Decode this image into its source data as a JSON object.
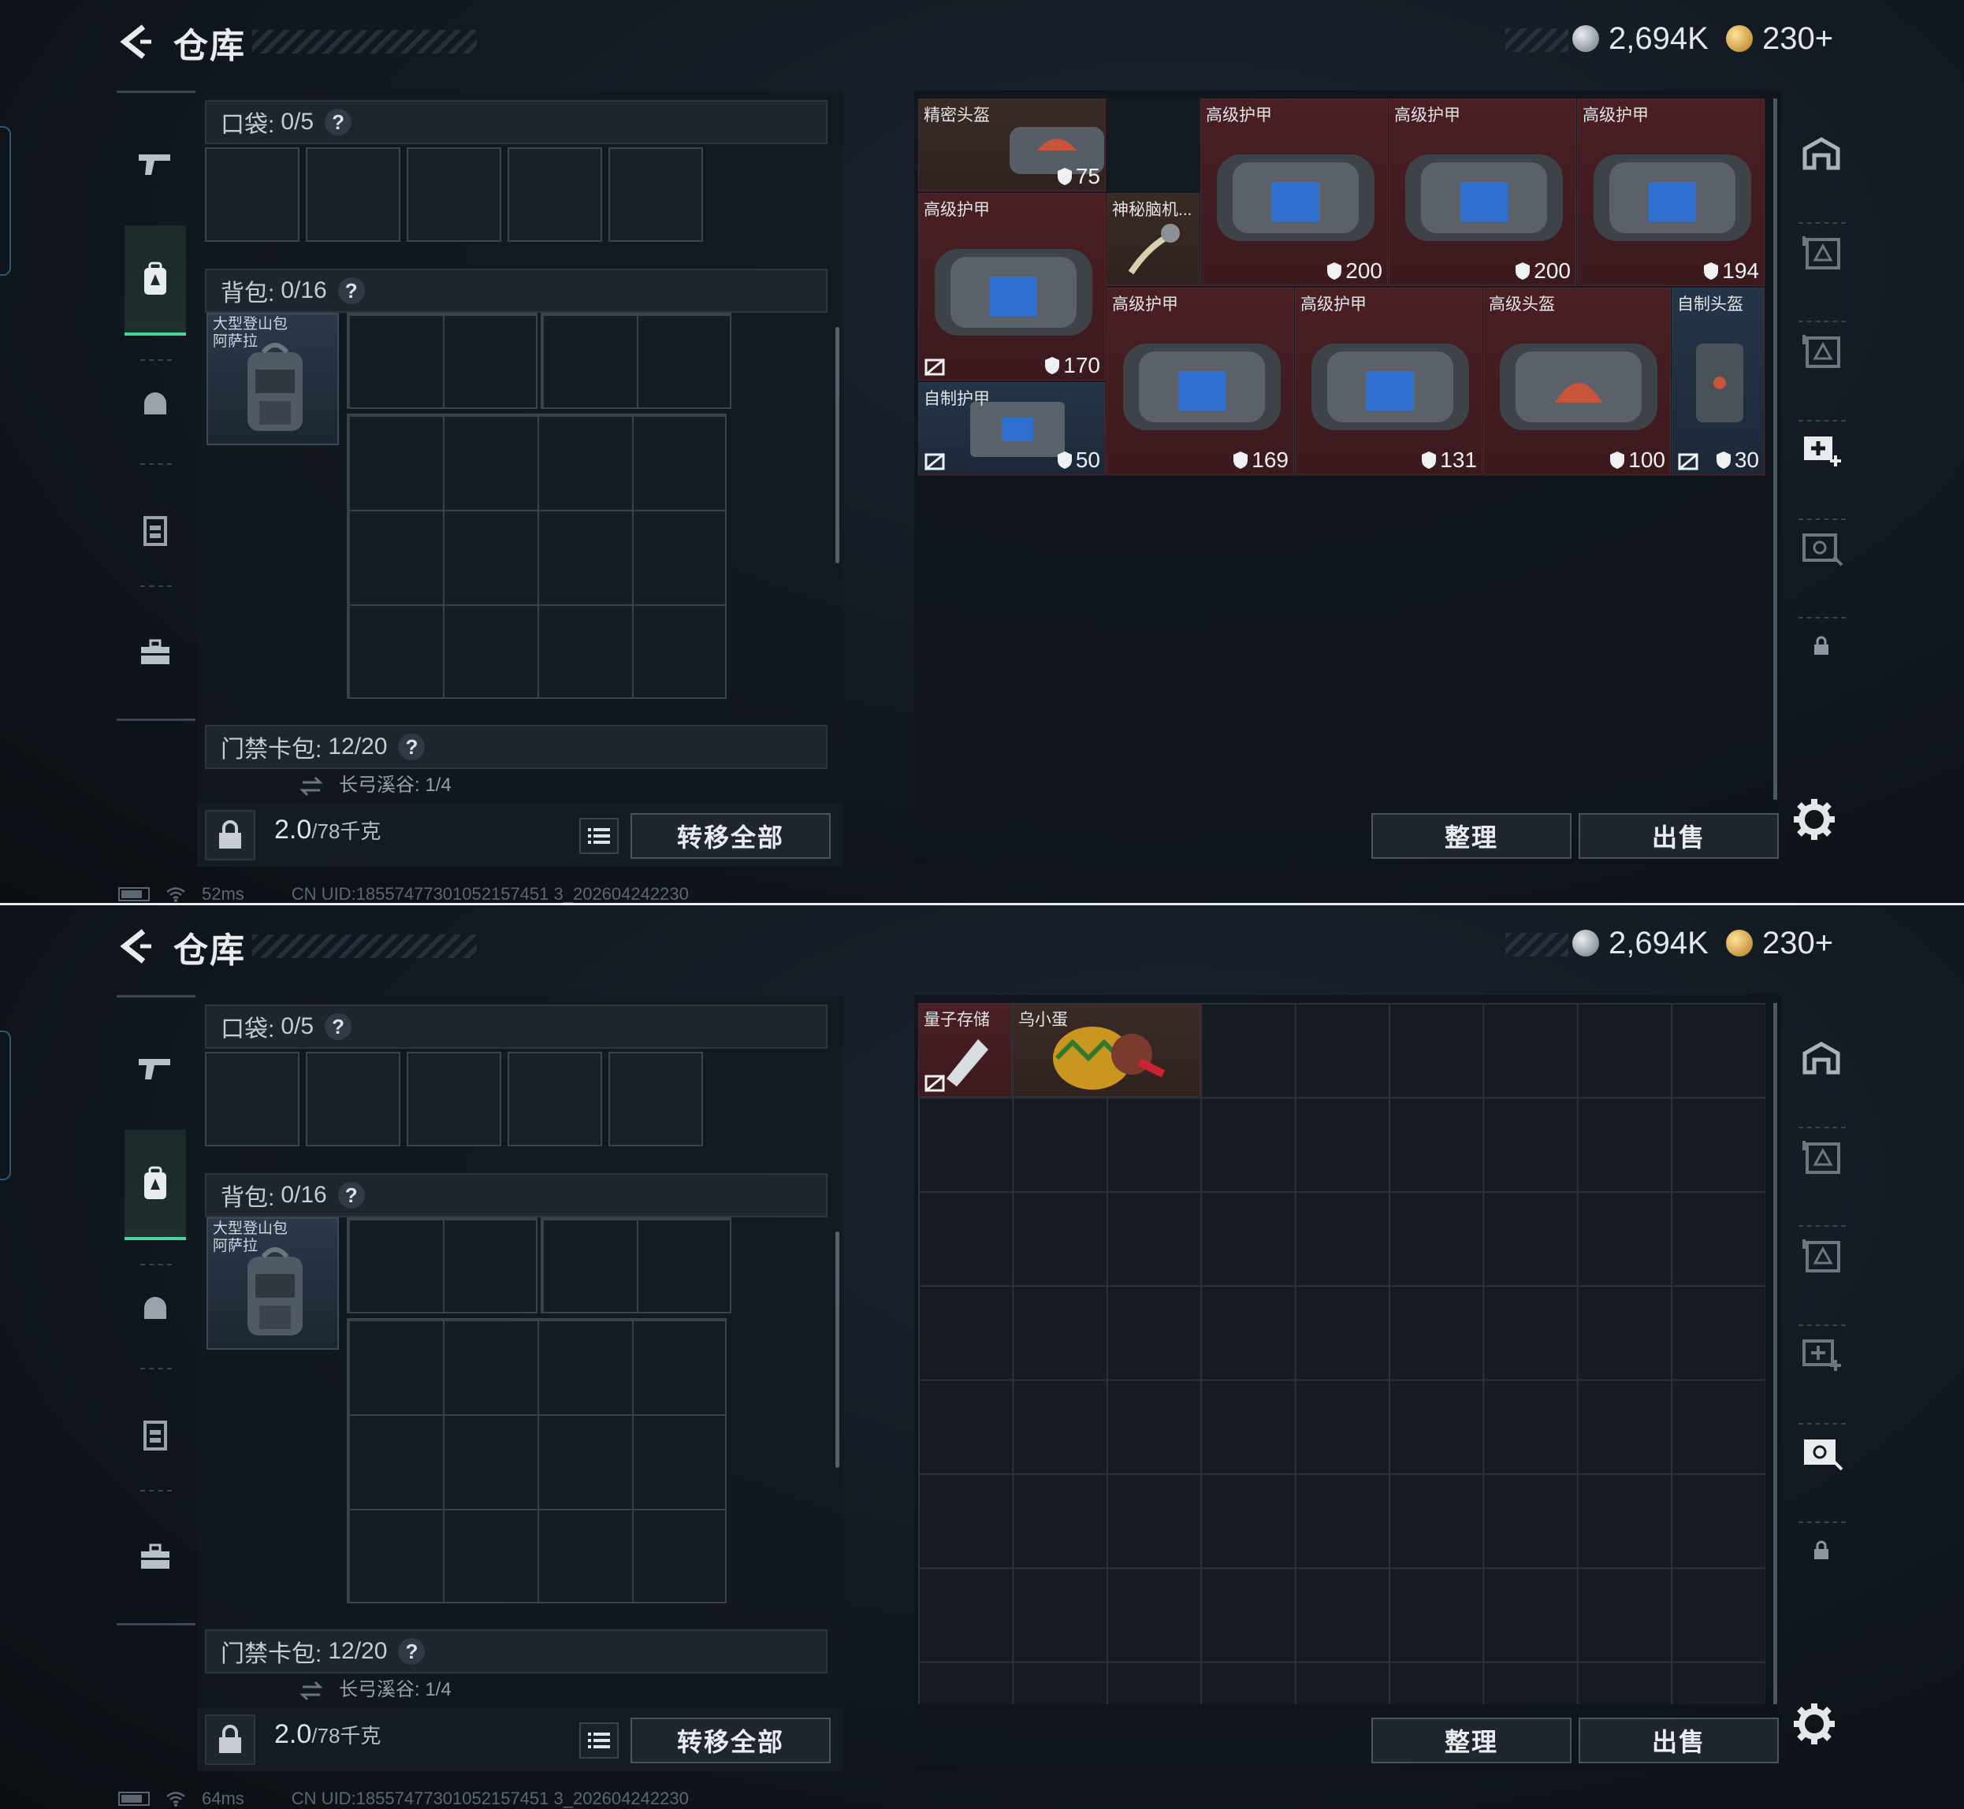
{
  "screens": [
    {
      "title": "仓库",
      "currency": {
        "silver": "2,694K",
        "gold": "230+"
      },
      "pocket": {
        "label": "口袋:",
        "value": "0/5"
      },
      "backpack": {
        "label": "背包:",
        "value": "0/16",
        "item_name": "大型登山包\n阿萨拉"
      },
      "card_pack": {
        "label": "门禁卡包:",
        "value": "12/20",
        "sub": "长弓溪谷: 1/4"
      },
      "weight": {
        "current": "2.0",
        "max": "/78千克"
      },
      "transfer_label": "转移全部",
      "organize_label": "整理",
      "sell_label": "出售",
      "ping": "52ms",
      "uid": "CN UID:18557477301052157451 3_202604242230",
      "items": [
        {
          "name": "精密头盔",
          "durability": "75"
        },
        {
          "name": "高级护甲",
          "durability": "200"
        },
        {
          "name": "高级护甲",
          "durability": "200"
        },
        {
          "name": "高级护甲",
          "durability": "194"
        },
        {
          "name": "高级护甲",
          "durability": "170"
        },
        {
          "name": "神秘脑机...",
          "durability": ""
        },
        {
          "name": "高级护甲",
          "durability": "169"
        },
        {
          "name": "高级护甲",
          "durability": "131"
        },
        {
          "name": "高级头盔",
          "durability": "100"
        },
        {
          "name": "自制头盔",
          "durability": "30"
        },
        {
          "name": "自制护甲",
          "durability": "50"
        }
      ]
    },
    {
      "title": "仓库",
      "currency": {
        "silver": "2,694K",
        "gold": "230+"
      },
      "pocket": {
        "label": "口袋:",
        "value": "0/5"
      },
      "backpack": {
        "label": "背包:",
        "value": "0/16",
        "item_name": "大型登山包\n阿萨拉"
      },
      "card_pack": {
        "label": "门禁卡包:",
        "value": "12/20",
        "sub": "长弓溪谷: 1/4"
      },
      "weight": {
        "current": "2.0",
        "max": "/78千克"
      },
      "transfer_label": "转移全部",
      "organize_label": "整理",
      "sell_label": "出售",
      "ping": "64ms",
      "uid": "CN UID:18557477301052157451 3_202604242230",
      "items": [
        {
          "name": "量子存储",
          "durability": ""
        },
        {
          "name": "乌小蛋",
          "durability": ""
        }
      ]
    }
  ],
  "icons": [
    "back-arrow-icon",
    "silver-coin-icon",
    "gold-coin-icon",
    "gun-icon",
    "backpack-icon",
    "helmet-icon",
    "chest-rig-icon",
    "toolbox-icon",
    "lock-icon",
    "list-icon",
    "swap-icon",
    "shield-icon",
    "no-bind-icon",
    "gear-icon",
    "battery-icon",
    "wifi-icon"
  ],
  "colors": {
    "accent_green": "#49d49a",
    "item_red": "#4a1f24",
    "item_brown": "#3a2a25",
    "item_blue": "#253548"
  }
}
